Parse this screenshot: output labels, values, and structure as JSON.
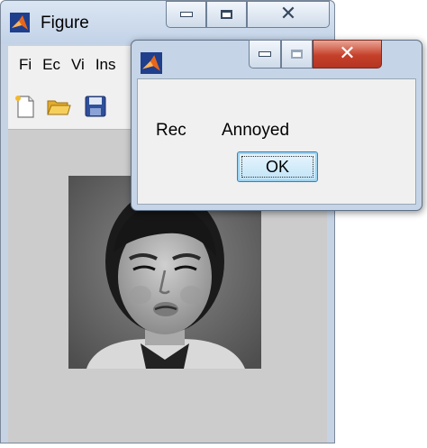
{
  "figure_window": {
    "title": "Figure",
    "menu": [
      "Fi",
      "Ec",
      "Vi",
      "Ins"
    ],
    "toolbar_icons": [
      "new-file-icon",
      "open-folder-icon",
      "save-icon"
    ],
    "image_description_icon": "face-photo"
  },
  "dialog": {
    "label": "Rec",
    "value": "Annoyed",
    "ok_label": "OK"
  },
  "colors": {
    "matlab_orange": "#e8671b",
    "matlab_blue": "#1f3e8c",
    "close_red": "#c6402a",
    "axes_bg": "#cccccc"
  }
}
